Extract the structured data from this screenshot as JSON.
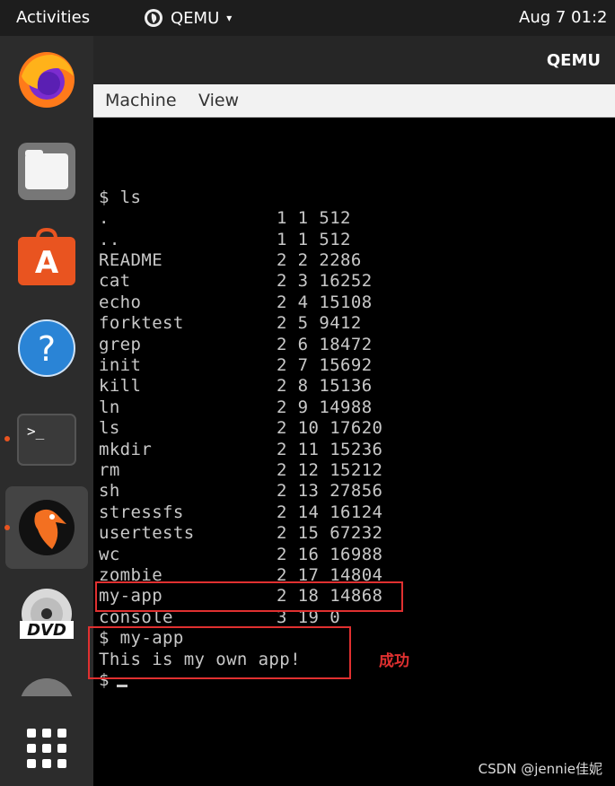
{
  "topbar": {
    "activities": "Activities",
    "app_name": "QEMU",
    "app_caret": "▾",
    "clock": "Aug 7  01:2"
  },
  "dock": {
    "items": [
      {
        "name": "firefox-icon",
        "running": false
      },
      {
        "name": "files-icon",
        "running": false
      },
      {
        "name": "software-center-icon",
        "running": false
      },
      {
        "name": "help-icon",
        "running": false,
        "glyph": "?"
      },
      {
        "name": "terminal-icon",
        "running": true,
        "glyph": ">_"
      },
      {
        "name": "qemu-icon",
        "running": true
      },
      {
        "name": "dvd-icon",
        "running": false,
        "glyph": "DVD"
      },
      {
        "name": "partial-icon",
        "running": false
      },
      {
        "name": "show-apps-icon",
        "running": false
      }
    ]
  },
  "window": {
    "title": "QEMU",
    "menu": {
      "machine": "Machine",
      "view": "View"
    }
  },
  "terminal": {
    "command_ls": "$ ls",
    "listing": [
      {
        "name": ".",
        "meta": "1 1 512"
      },
      {
        "name": "..",
        "meta": "1 1 512"
      },
      {
        "name": "README",
        "meta": "2 2 2286"
      },
      {
        "name": "cat",
        "meta": "2 3 16252"
      },
      {
        "name": "echo",
        "meta": "2 4 15108"
      },
      {
        "name": "forktest",
        "meta": "2 5 9412"
      },
      {
        "name": "grep",
        "meta": "2 6 18472"
      },
      {
        "name": "init",
        "meta": "2 7 15692"
      },
      {
        "name": "kill",
        "meta": "2 8 15136"
      },
      {
        "name": "ln",
        "meta": "2 9 14988"
      },
      {
        "name": "ls",
        "meta": "2 10 17620"
      },
      {
        "name": "mkdir",
        "meta": "2 11 15236"
      },
      {
        "name": "rm",
        "meta": "2 12 15212"
      },
      {
        "name": "sh",
        "meta": "2 13 27856"
      },
      {
        "name": "stressfs",
        "meta": "2 14 16124"
      },
      {
        "name": "usertests",
        "meta": "2 15 67232"
      },
      {
        "name": "wc",
        "meta": "2 16 16988"
      },
      {
        "name": "zombie",
        "meta": "2 17 14804"
      },
      {
        "name": "my-app",
        "meta": "2 18 14868"
      },
      {
        "name": "console",
        "meta": "3 19 0"
      }
    ],
    "command_app": "$ my-app",
    "app_output": "This is my own app!",
    "prompt": "$"
  },
  "annotation": "成功",
  "watermark": "CSDN @jennie佳妮",
  "colors": {
    "highlight_box": "#e03030",
    "accent": "#e95420"
  }
}
